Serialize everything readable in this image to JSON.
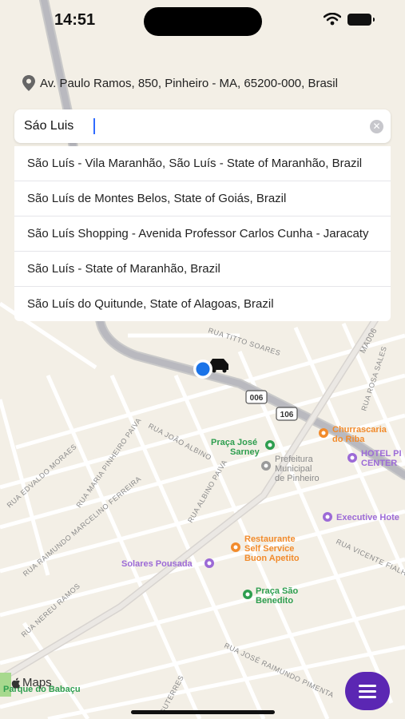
{
  "status_bar": {
    "time": "14:51"
  },
  "location": {
    "address": "Av. Paulo Ramos, 850, Pinheiro - MA, 65200-000, Brasil"
  },
  "search": {
    "value": "Sáo Luis",
    "placeholder": ""
  },
  "suggestions": [
    "São Luís - Vila Maranhão, São Luís - State of Maranhão, Brazil",
    "São Luís de Montes Belos, State of Goiás, Brazil",
    "São Luís Shopping - Avenida Professor Carlos Cunha - Jaracaty",
    "São Luís - State of Maranhão, Brazil",
    "São Luís do Quitunde, State of Alagoas, Brazil"
  ],
  "map": {
    "streets": [
      "RUA TITTO SOARES",
      "RUA ROSA SALES",
      "RUA JOÃO ALBINO",
      "RUA MARIA PINHEIRO PAIVA",
      "RUA EDVALDO MORAES",
      "RUA RAIMUNDO MARCELINO FERREIRA",
      "RUA NEREU RAMOS",
      "RUA ALBINO PAIVA",
      "RUA VICENTE FIALHO",
      "RUA JOSÉ RAIMUNDO PIMENTA",
      "MA006",
      "GUTERRES"
    ],
    "shields": [
      "006",
      "106"
    ],
    "pois": {
      "praca_jose_sarney": "Praça José\nSarney",
      "prefeitura": "Prefeitura\nMunicipal\nde Pinheiro",
      "churrascaria": "Churrascaria\ndo Riba",
      "hotel": "HOTEL PI\nCENTER",
      "executive": "Executive Hote",
      "restaurante": "Restaurante\nSelf Service\nBuon Apetito",
      "solares": "Solares Pousada",
      "praca_sao_benedito": "Praça São\nBenedito",
      "parque": "Parque do Babaçu"
    },
    "attribution": "Maps"
  },
  "colors": {
    "accent": "#5b27b3",
    "user_dot": "#1a73e8",
    "green_poi": "#2e9e4f",
    "orange_poi": "#f28b2c",
    "purple_poi": "#9c6ad6"
  }
}
